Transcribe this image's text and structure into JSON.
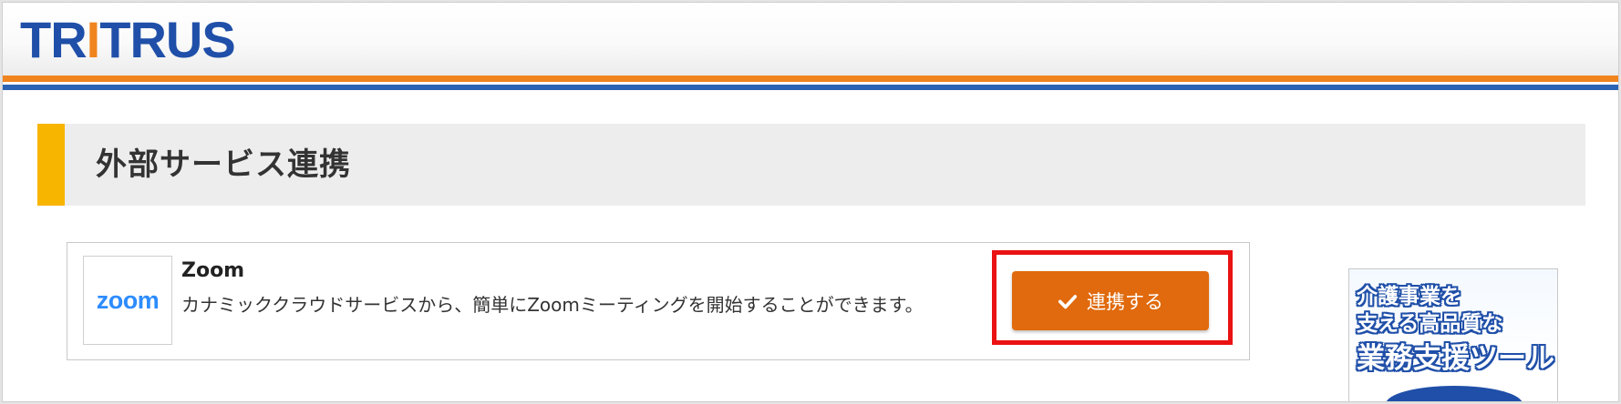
{
  "header": {
    "logo_text": "TRITRUS",
    "logo_blue": "#1f4fa8",
    "logo_orange": "#f0841e"
  },
  "page": {
    "title": "外部サービス連携",
    "accent_color": "#f7b500"
  },
  "services": [
    {
      "logo_text": "zoom",
      "name": "Zoom",
      "description": "カナミッククラウドサービスから、簡単にZoomミーティングを開始することができます。",
      "action_label": "連携する",
      "action_icon": "check-icon",
      "action_color": "#e06a0d",
      "highlight_color": "#ea1212"
    }
  ],
  "side_banner": {
    "line1": "介護事業を",
    "line2": "支える高品質な",
    "line3": "業務支援ツール"
  }
}
